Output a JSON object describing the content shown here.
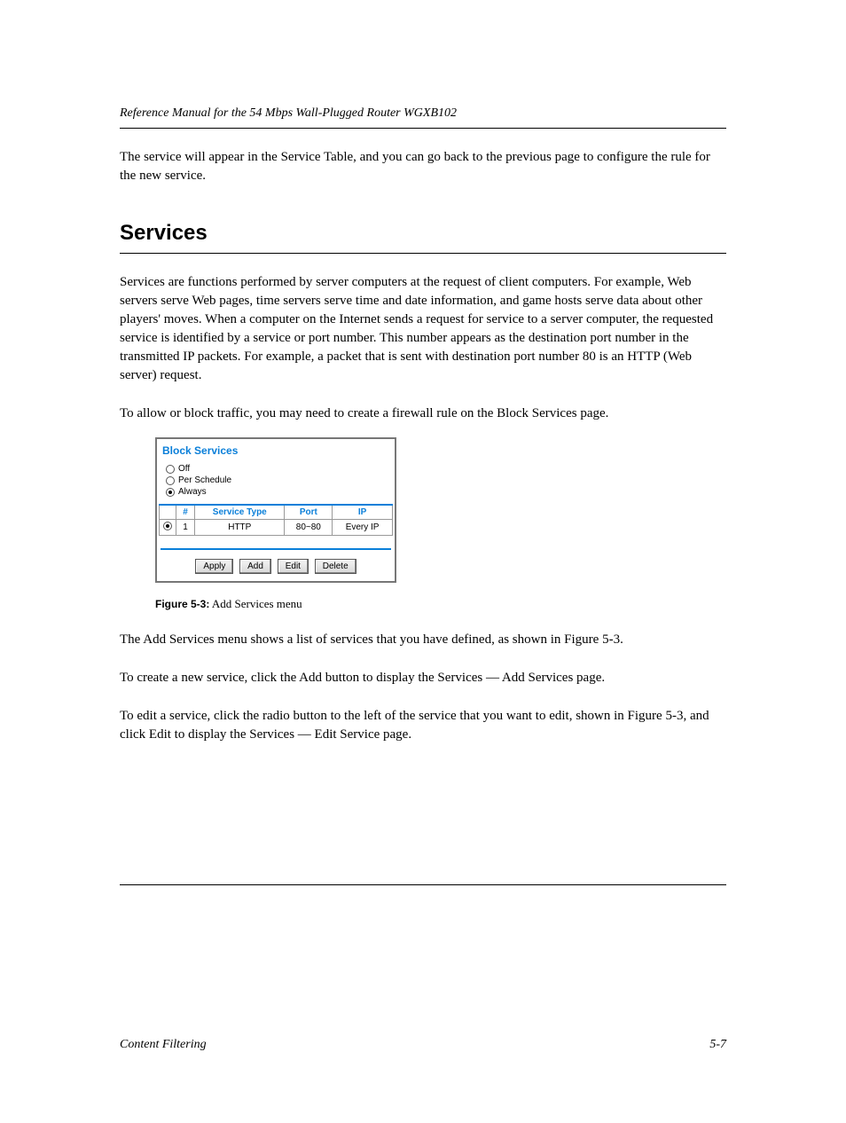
{
  "header": {
    "running_title": "Reference Manual for the 54 Mbps Wall-Plugged Router WGXB102"
  },
  "para1": "The service will appear in the Service Table, and you can go back to the previous page to configure the rule for the new service.",
  "section_title": "Services",
  "para2": "Services are functions performed by server computers at the request of client computers. For example, Web servers serve Web pages, time servers serve time and date information, and game hosts serve data about other players' moves. When a computer on the Internet sends a request for service to a server computer, the requested service is identified by a service or port number. This number appears as the destination port number in the transmitted IP packets. For example, a packet that is sent with destination port number 80 is an HTTP (Web server) request.",
  "para3": "To allow or block traffic, you may need to create a firewall rule on the Block Services page.",
  "panel": {
    "title": "Block Services",
    "radios": {
      "off": "Off",
      "per_schedule": "Per Schedule",
      "always": "Always",
      "selected": "always"
    },
    "table": {
      "headers": {
        "num": "#",
        "type": "Service Type",
        "port": "Port",
        "ip": "IP"
      },
      "rows": [
        {
          "selected": true,
          "num": "1",
          "type": "HTTP",
          "port": "80~80",
          "ip": "Every IP"
        }
      ]
    },
    "buttons": {
      "apply": "Apply",
      "add": "Add",
      "edit": "Edit",
      "delete": "Delete"
    }
  },
  "figure_caption": {
    "label": "Figure 5-3:",
    "text": " Add Services menu"
  },
  "para4": "The Add Services menu shows a list of services that you have defined, as shown in",
  "para4_ref": "Figure 5-3",
  "para4_tail": ".",
  "para5": "To create a new service, click the Add button to display the Services — Add Services page.",
  "para6_a": "To edit a service, click the radio button to the left of the service that you want to edit, shown in",
  "para6_ref": "Figure 5-3",
  "para6_b": ", and click Edit to display the Services — Edit Service page.",
  "footer": {
    "left": "Content Filtering",
    "right": "5-7"
  }
}
